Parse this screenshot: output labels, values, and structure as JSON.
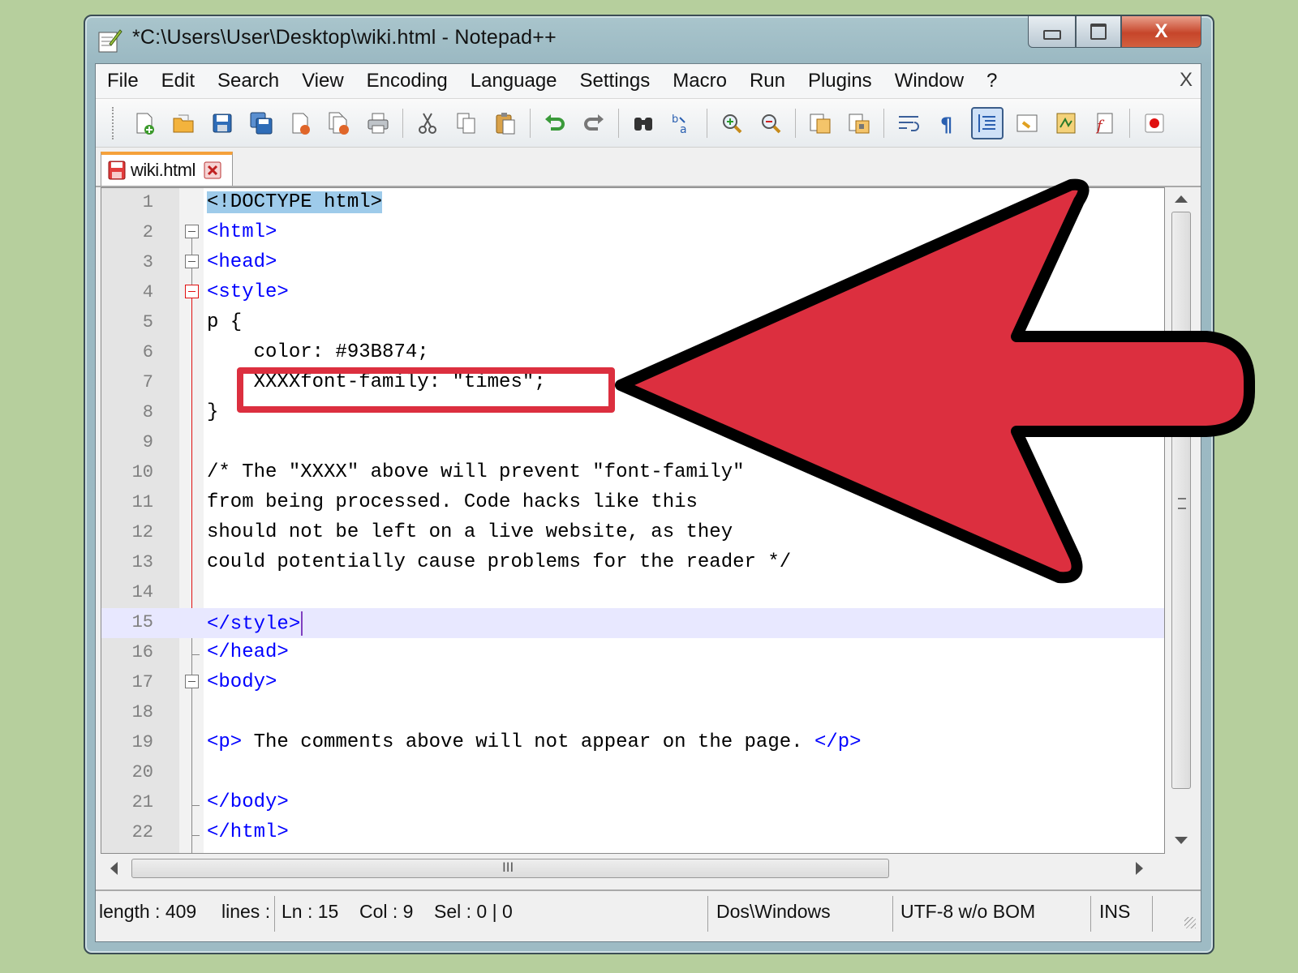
{
  "window": {
    "title": "*C:\\Users\\User\\Desktop\\wiki.html - Notepad++",
    "min_label": "▭",
    "max_label": "▢",
    "close_label": "X"
  },
  "menu": {
    "items": [
      "File",
      "Edit",
      "Search",
      "View",
      "Encoding",
      "Language",
      "Settings",
      "Macro",
      "Run",
      "Plugins",
      "Window",
      "?"
    ],
    "close": "X"
  },
  "toolbar": {
    "icons": [
      "new-file-icon",
      "open-file-icon",
      "save-icon",
      "save-all-icon",
      "close-icon",
      "close-all-icon",
      "print-icon",
      "cut-icon",
      "copy-icon",
      "paste-icon",
      "undo-icon",
      "redo-icon",
      "find-icon",
      "replace-icon",
      "zoom-in-icon",
      "zoom-out-icon",
      "sync-vertical-icon",
      "sync-horizontal-icon",
      "word-wrap-icon",
      "show-all-chars-icon",
      "indent-guide-icon",
      "doc-map-icon",
      "function-list-icon",
      "folder-workspace-icon",
      "record-macro-icon"
    ]
  },
  "tab": {
    "label": "wiki.html"
  },
  "editor": {
    "lines": [
      {
        "n": "1",
        "text": "<!DOCTYPE html>"
      },
      {
        "n": "2",
        "text": "<html>"
      },
      {
        "n": "3",
        "text": "<head>"
      },
      {
        "n": "4",
        "text": "<style>"
      },
      {
        "n": "5",
        "text": "p {"
      },
      {
        "n": "6",
        "text": "    color: #93B874;"
      },
      {
        "n": "7",
        "text": "    XXXXfont-family: \"times\";"
      },
      {
        "n": "8",
        "text": "}"
      },
      {
        "n": "9",
        "text": ""
      },
      {
        "n": "10",
        "text": "/* The \"XXXX\" above will prevent \"font-family\""
      },
      {
        "n": "11",
        "text": "from being processed. Code hacks like this"
      },
      {
        "n": "12",
        "text": "should not be left on a live website, as they"
      },
      {
        "n": "13",
        "text": "could potentially cause problems for the reader */"
      },
      {
        "n": "14",
        "text": ""
      },
      {
        "n": "15",
        "text": "</style>"
      },
      {
        "n": "16",
        "text": "</head>"
      },
      {
        "n": "17",
        "text": "<body>"
      },
      {
        "n": "18",
        "text": ""
      },
      {
        "n": "19",
        "p_open": "<p>",
        "p_text": " The comments above will not appear on the page. ",
        "p_close": "</p>"
      },
      {
        "n": "20",
        "text": ""
      },
      {
        "n": "21",
        "text": "</body>"
      },
      {
        "n": "22",
        "text": "</html>"
      }
    ],
    "hscroll_grip": "III"
  },
  "status": {
    "length": "length : 409",
    "lines": "lines :",
    "ln": "Ln : 15",
    "col": "Col : 9",
    "sel": "Sel : 0 | 0",
    "eol": "Dos\\Windows",
    "encoding": "UTF-8 w/o BOM",
    "mode": "INS"
  },
  "colors": {
    "annotation_red": "#dc2f3f",
    "tag_blue": "#0000ff",
    "background_green": "#b6cf9d"
  }
}
